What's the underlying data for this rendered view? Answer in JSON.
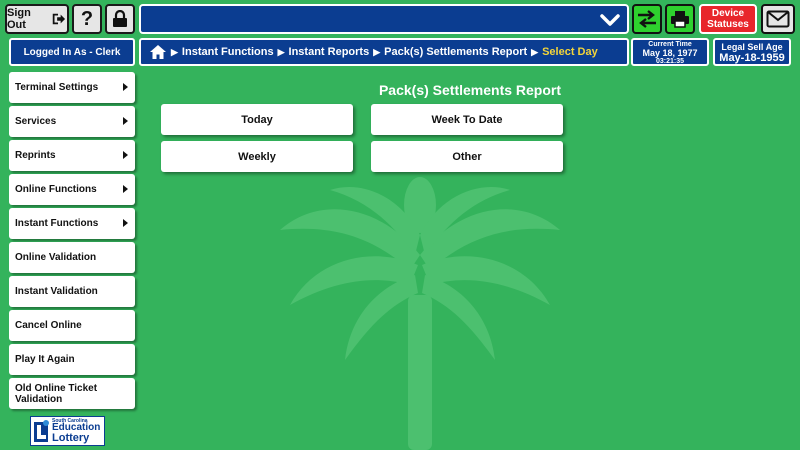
{
  "topbar": {
    "signout_label": "Sign Out",
    "help_label": "?",
    "device_statuses_label": "Device Statuses"
  },
  "session": {
    "logged_in_label": "Logged In As - Clerk"
  },
  "breadcrumb": {
    "items": [
      "Instant Functions",
      "Instant Reports",
      "Pack(s) Settlements Report"
    ],
    "current": "Select Day"
  },
  "clock": {
    "label": "Current Time",
    "date": "May 18, 1977",
    "time": "03:21:35"
  },
  "legal_age": {
    "label": "Legal Sell Age",
    "value": "May-18-1959"
  },
  "sidebar": {
    "items": [
      {
        "label": "Terminal Settings"
      },
      {
        "label": "Services"
      },
      {
        "label": "Reprints"
      },
      {
        "label": "Online Functions"
      },
      {
        "label": "Instant Functions"
      },
      {
        "label": "Online Validation"
      },
      {
        "label": "Instant Validation"
      },
      {
        "label": "Cancel Online"
      },
      {
        "label": "Play It Again"
      },
      {
        "label": "Old Online Ticket Validation"
      }
    ]
  },
  "logo": {
    "line1": "South Carolina",
    "line2": "Education",
    "line3": "Lottery"
  },
  "main": {
    "title": "Pack(s) Settlements Report",
    "options": [
      "Today",
      "Week To Date",
      "Weekly",
      "Other"
    ]
  },
  "colors": {
    "background": "#34b35c",
    "navy": "#0b3d91",
    "accent_green": "#2ed12e",
    "alert_red": "#e8262b",
    "crumb_current": "#f3d53a"
  }
}
